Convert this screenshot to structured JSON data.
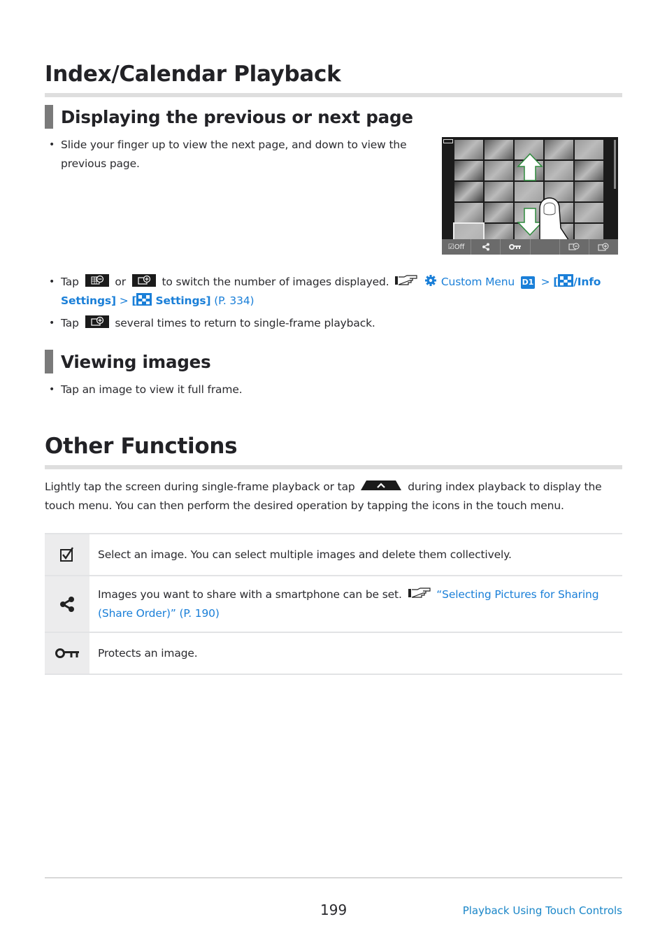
{
  "heading_index": "Index/Calendar Playback",
  "sub_prev_next": "Displaying the previous or next page",
  "bullet_slide": "Slide your finger up to view the next page, and down to view the previous page.",
  "camera_screen": {
    "toolbar": [
      {
        "icon": "checkbox-off-icon",
        "label": "Off"
      },
      {
        "icon": "share-icon",
        "label": ""
      },
      {
        "icon": "protect-key-icon",
        "label": ""
      },
      {
        "icon": "blank",
        "label": ""
      },
      {
        "icon": "index-zoom-out-icon",
        "label": ""
      },
      {
        "icon": "zoom-in-icon",
        "label": ""
      }
    ],
    "gestures": [
      "up-arrow-icon",
      "down-arrow-icon",
      "finger-icon"
    ]
  },
  "bullet_tap_switch": {
    "tap": "Tap",
    "or": "or",
    "rest": "to switch the number of images displayed.",
    "link_custom_menu": "Custom Menu",
    "badge": "D1",
    "gt1": ">",
    "link_info_bracket_open": "[",
    "link_info_settings": "/Info Settings]",
    "gt2": ">",
    "link_settings_open": "[",
    "link_settings": "Settings]",
    "page_ref": "(P. 334)"
  },
  "bullet_tap_return": {
    "tap": "Tap",
    "rest": "several times to return to single-frame playback."
  },
  "sub_viewing": "Viewing images",
  "bullet_view": "Tap an image to view it full frame.",
  "heading_other": "Other Functions",
  "other_intro": {
    "part1": "Lightly tap the screen during single-frame playback or tap",
    "part2": "during index playback to display the touch menu. You can then perform the desired operation by tapping the icons in the touch menu."
  },
  "functions": [
    {
      "icon": "checkbox-icon",
      "text": "Select an image. You can select multiple images and delete them collectively.",
      "link": "",
      "link_page": ""
    },
    {
      "icon": "share-icon",
      "text": "Images you want to share with a smartphone can be set.",
      "link": "“Selecting Pictures for Sharing (Share Order)”",
      "link_page": "(P. 190)"
    },
    {
      "icon": "key-icon",
      "text": "Protects an image.",
      "link": "",
      "link_page": ""
    }
  ],
  "footer": {
    "page_number": "199",
    "section": "Playback Using Touch Controls"
  },
  "colors": {
    "link": "#1a7fd8",
    "heading_bar": "#7a7a7a",
    "rule": "#dedede"
  }
}
